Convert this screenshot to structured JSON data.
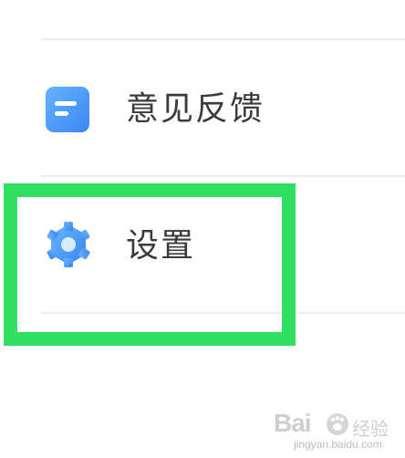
{
  "menu": {
    "items": [
      {
        "id": "feedback",
        "label": "意见反馈",
        "icon": "document-icon",
        "icon_color": "#4f9cf9"
      },
      {
        "id": "settings",
        "label": "设置",
        "icon": "gear-icon",
        "icon_color": "#4f9cf9"
      }
    ]
  },
  "highlight": {
    "target": "settings",
    "color": "#31e060"
  },
  "watermark": {
    "logo": "Bai",
    "text": "经验",
    "url": "jingyan.baidu.com"
  }
}
